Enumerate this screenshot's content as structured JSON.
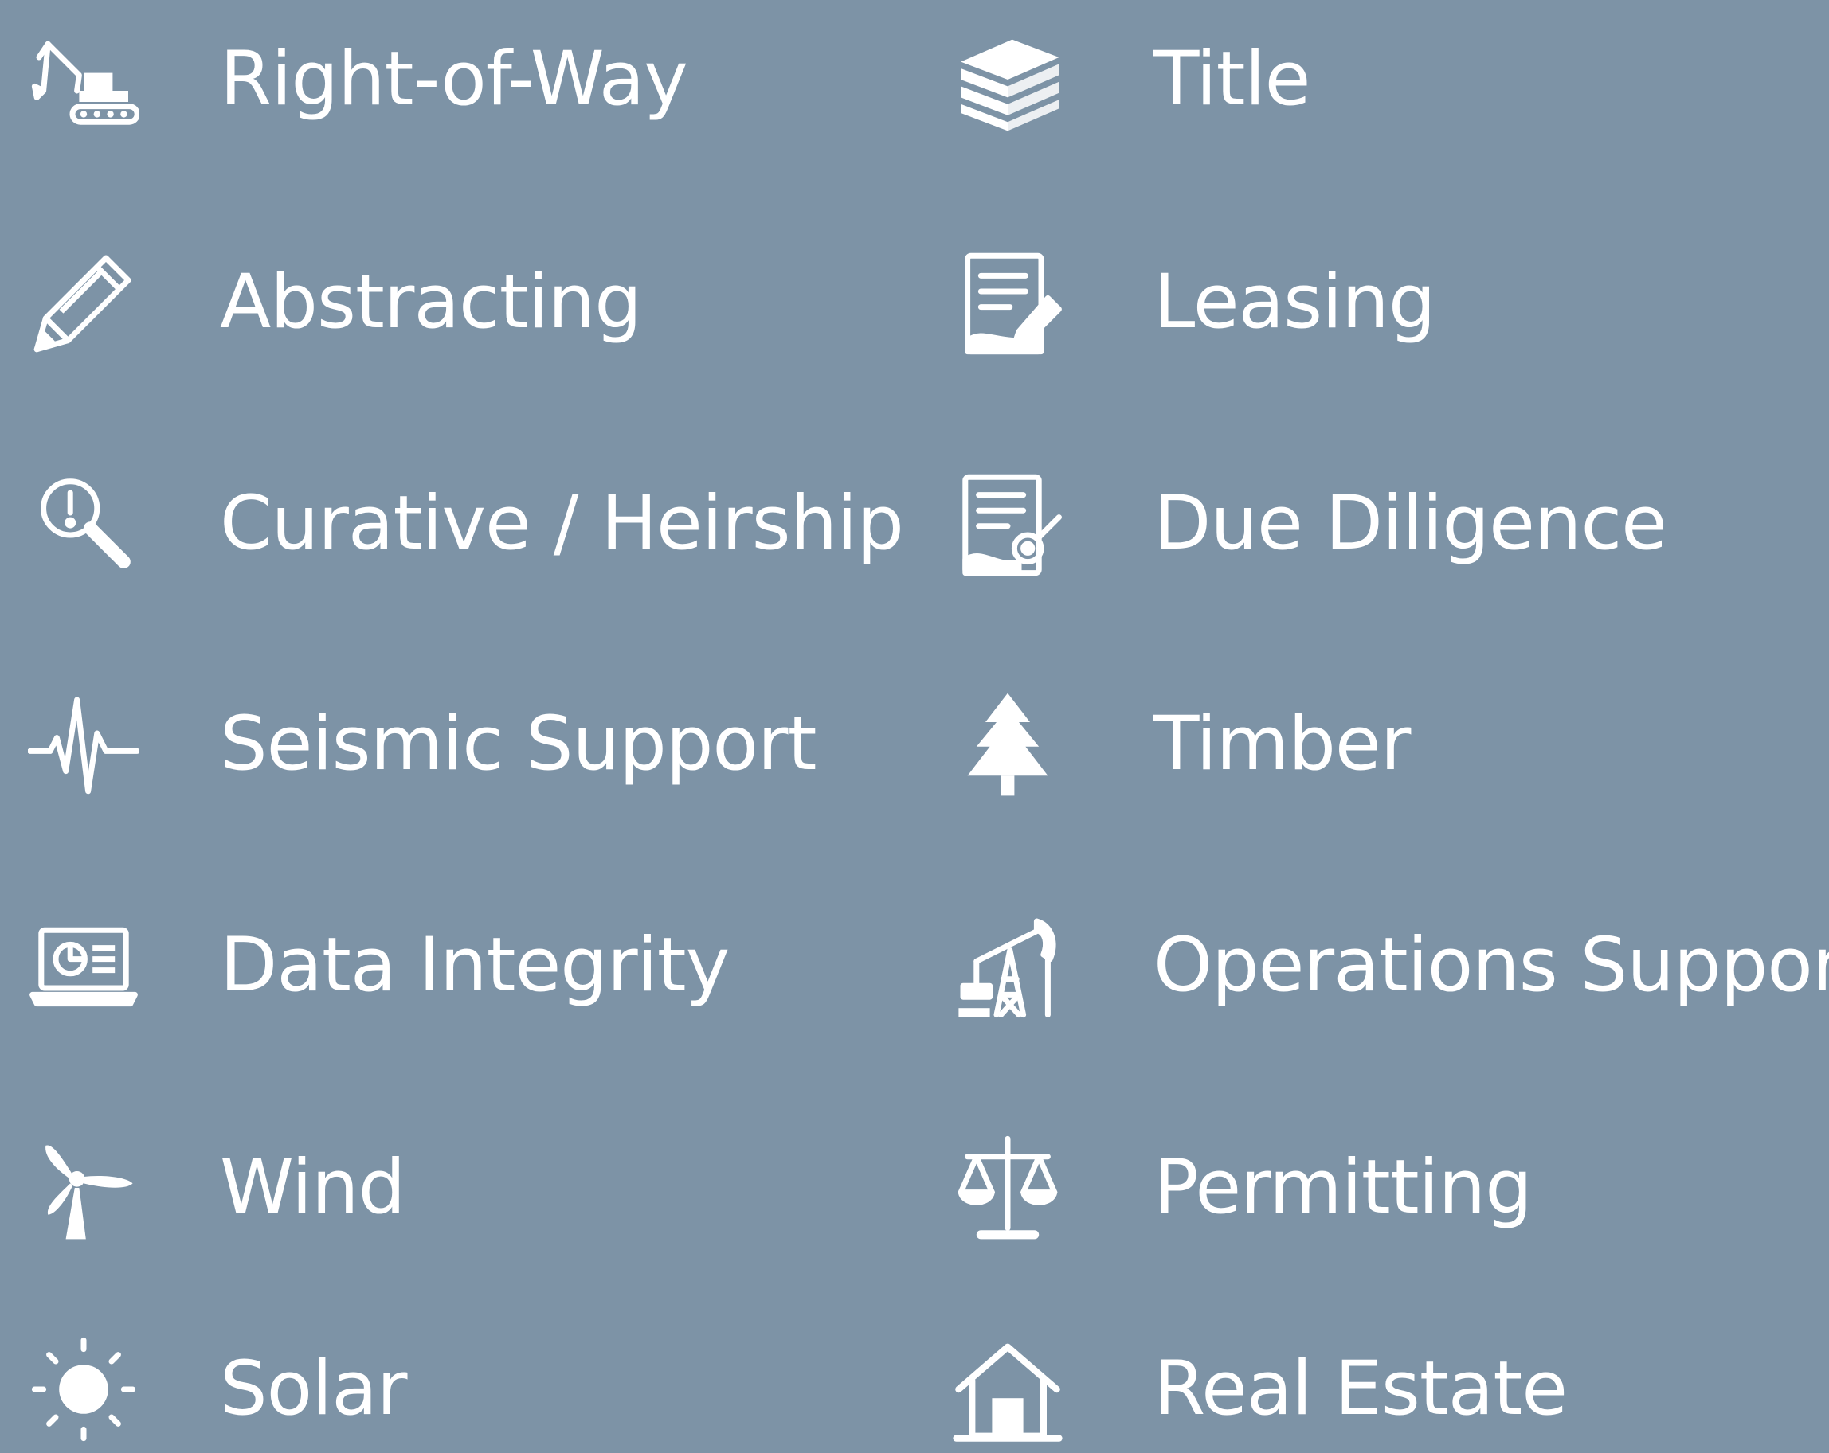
{
  "colors": {
    "background": "#7d93a6",
    "foreground": "#ffffff"
  },
  "services": {
    "left": [
      {
        "label": "Right-of-Way",
        "icon": "excavator-icon"
      },
      {
        "label": "Abstracting",
        "icon": "pencil-icon"
      },
      {
        "label": "Curative / Heirship",
        "icon": "magnifier-alert-icon"
      },
      {
        "label": "Seismic Support",
        "icon": "seismic-wave-icon"
      },
      {
        "label": "Data Integrity",
        "icon": "laptop-chart-icon"
      },
      {
        "label": "Wind",
        "icon": "wind-turbine-icon"
      },
      {
        "label": "Solar",
        "icon": "sun-icon"
      }
    ],
    "right": [
      {
        "label": "Title",
        "icon": "books-stack-icon"
      },
      {
        "label": "Leasing",
        "icon": "document-pen-icon"
      },
      {
        "label": "Due Diligence",
        "icon": "document-seal-icon"
      },
      {
        "label": "Timber",
        "icon": "pine-tree-icon"
      },
      {
        "label": "Operations Support",
        "icon": "oil-pump-jack-icon"
      },
      {
        "label": "Permitting",
        "icon": "scales-icon"
      },
      {
        "label": "Real Estate",
        "icon": "house-icon"
      }
    ]
  }
}
